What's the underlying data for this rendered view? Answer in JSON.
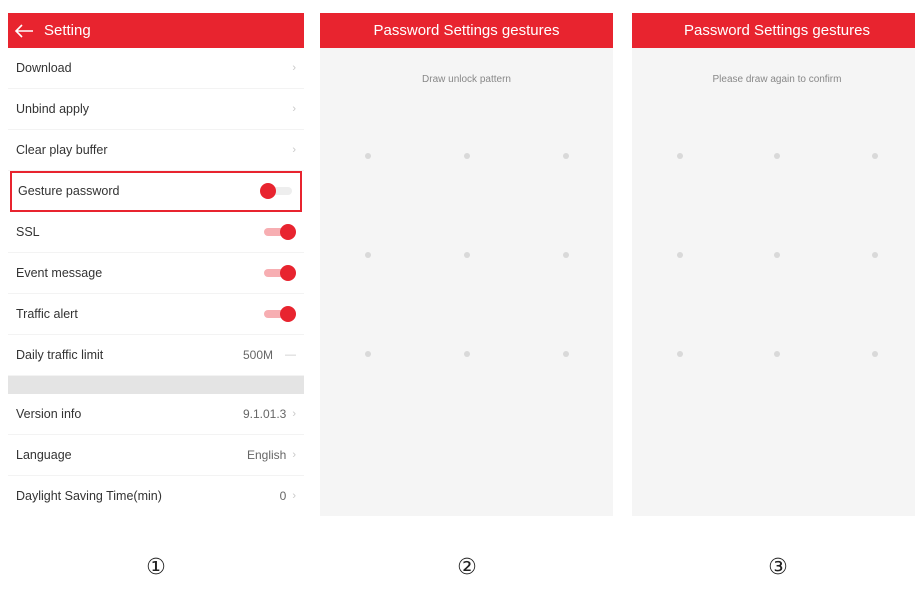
{
  "screen1": {
    "title": "Setting",
    "rows": [
      {
        "label": "Download"
      },
      {
        "label": "Unbind apply"
      },
      {
        "label": "Clear play buffer"
      },
      {
        "label": "Gesture password",
        "toggle": "off"
      },
      {
        "label": "SSL",
        "toggle": "on"
      },
      {
        "label": "Event message",
        "toggle": "on"
      },
      {
        "label": "Traffic alert",
        "toggle": "on"
      },
      {
        "label": "Daily traffic limit",
        "value": "500M"
      }
    ],
    "rows2": [
      {
        "label": "Version info",
        "value": "9.1.01.3"
      },
      {
        "label": "Language",
        "value": "English"
      },
      {
        "label": "Daylight Saving Time(min)",
        "value": "0"
      }
    ]
  },
  "screen2": {
    "title": "Password Settings gestures",
    "hint": "Draw unlock pattern"
  },
  "screen3": {
    "title": "Password Settings gestures",
    "hint": "Please draw again to confirm"
  },
  "captions": [
    "①",
    "②",
    "③"
  ],
  "colors": {
    "accent": "#e8242f"
  }
}
